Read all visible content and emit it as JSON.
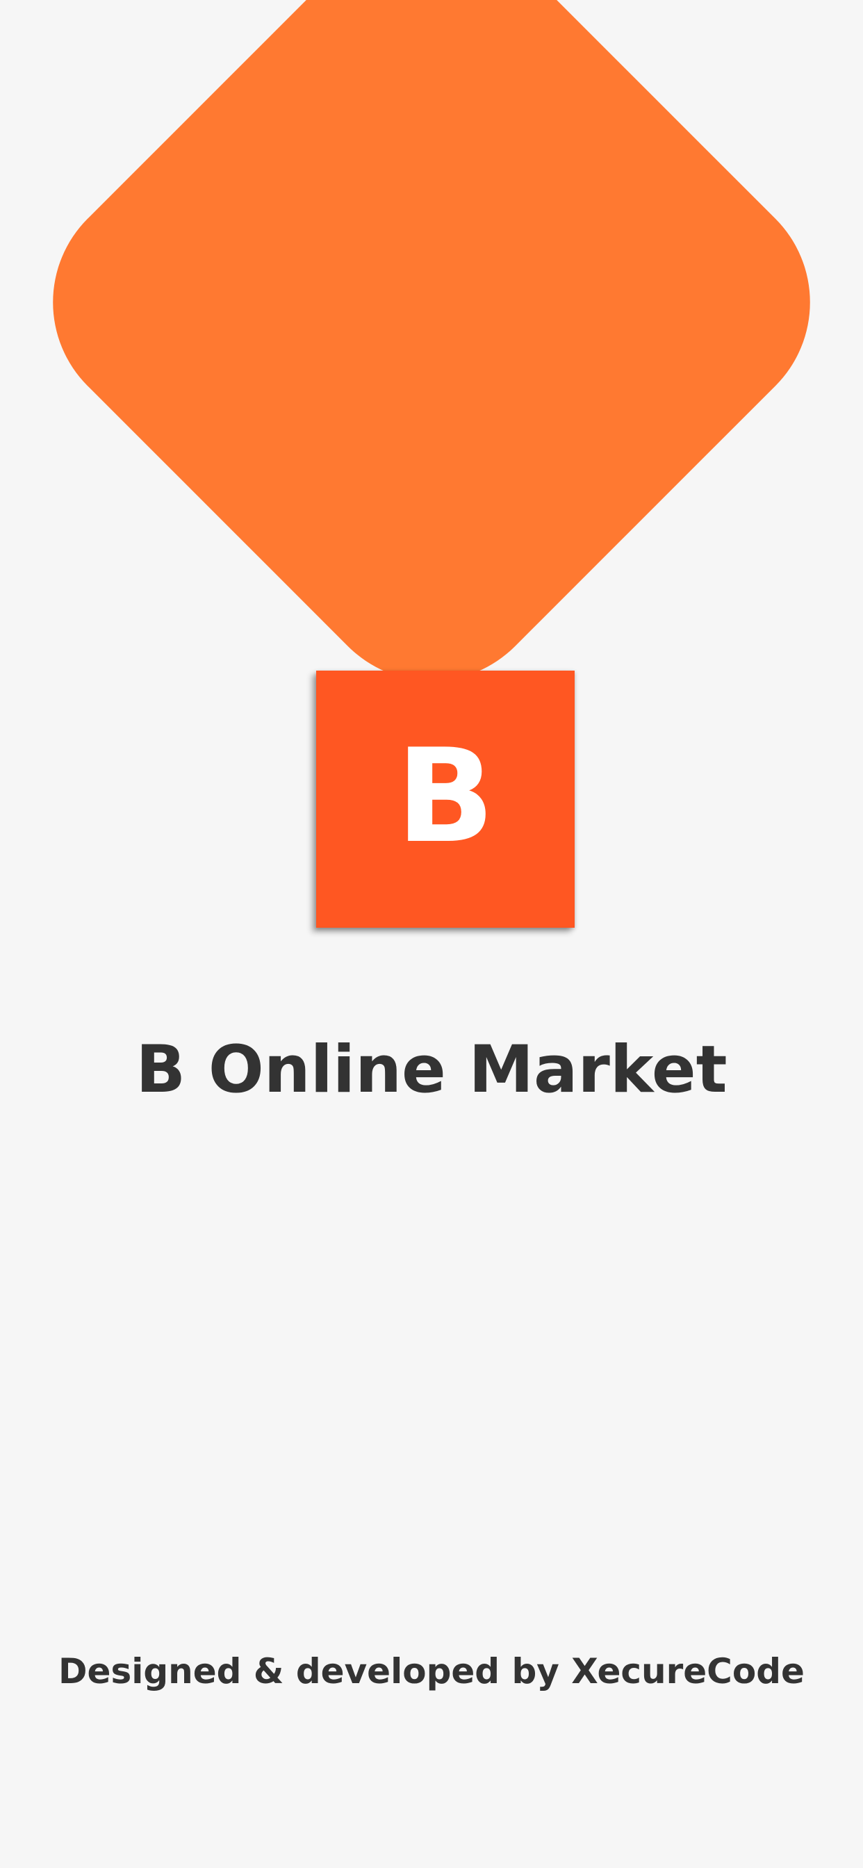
{
  "colors": {
    "background": "#f6f6f6",
    "diamond": "#ff7931",
    "logo_tile": "#ff5722",
    "logo_text": "#ffffff",
    "text": "#333333"
  },
  "logo": {
    "letter": "B",
    "icon": "b-logo-icon"
  },
  "app": {
    "name": "B Online Market"
  },
  "footer": {
    "credits": "Designed & developed by XecureCode"
  }
}
